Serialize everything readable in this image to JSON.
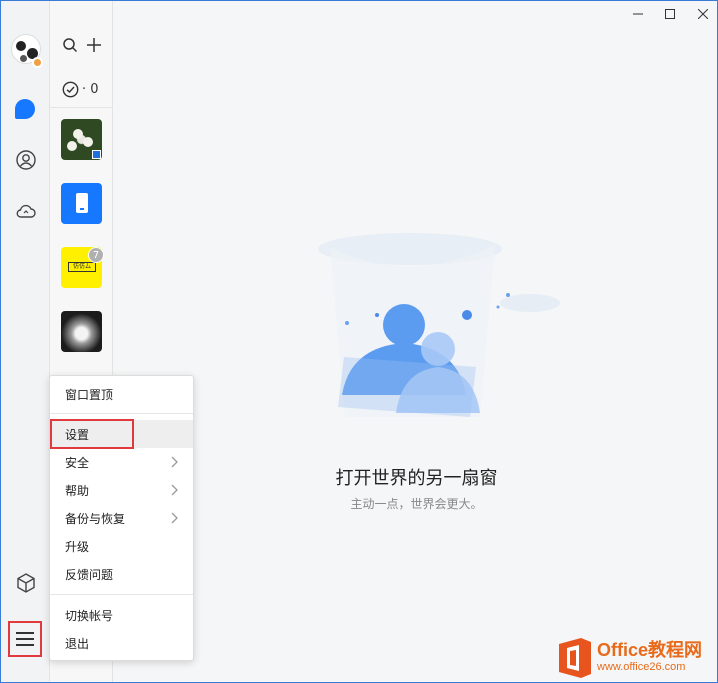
{
  "list": {
    "todo_count": "· 0",
    "unread_badge": "7",
    "thumb_label": "仿仿ム"
  },
  "main": {
    "slogan_title": "打开世界的另一扇窗",
    "slogan_subtitle": "主动一点，世界会更大。"
  },
  "menu": {
    "items": [
      {
        "label": "窗口置顶"
      },
      {
        "label": "设置"
      },
      {
        "label": "安全"
      },
      {
        "label": "帮助"
      },
      {
        "label": "备份与恢复"
      },
      {
        "label": "升级"
      },
      {
        "label": "反馈问题"
      },
      {
        "label": "切换帐号"
      },
      {
        "label": "退出"
      }
    ]
  },
  "watermark": {
    "title": "Office教程网",
    "url": "www.office26.com"
  },
  "colors": {
    "accent": "#1677ff",
    "highlight": "#e0393e",
    "watermark": "#e76b1a"
  }
}
